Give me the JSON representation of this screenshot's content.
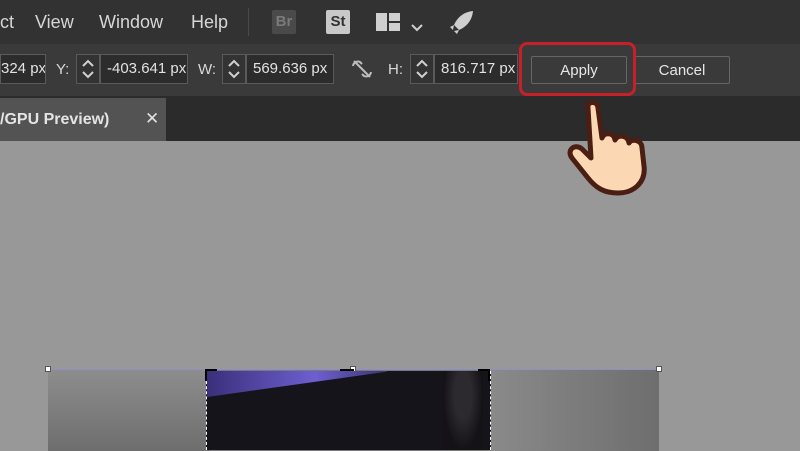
{
  "menu": {
    "items": [
      "ct",
      "View",
      "Window",
      "Help"
    ],
    "app_icons": {
      "bridge": "Br",
      "stock": "St"
    },
    "icons": [
      "workspace-layout-icon",
      "chevron-down-icon",
      "rocket-icon"
    ]
  },
  "control_bar": {
    "x_value": "324 px",
    "y_label": "Y:",
    "y_value": "-403.641 px",
    "w_label": "W:",
    "w_value": "569.636 px",
    "h_label": "H:",
    "h_value": "816.717 px",
    "apply_label": "Apply",
    "cancel_label": "Cancel"
  },
  "tab": {
    "label": "/GPU Preview)",
    "close": "✕"
  },
  "colors": {
    "menubar": "#323232",
    "controlbar": "#3a3a3a",
    "canvas": "#989898",
    "highlight": "#c8202a",
    "hand_fill": "#fbd7b3",
    "hand_outline": "#4a1e12"
  }
}
